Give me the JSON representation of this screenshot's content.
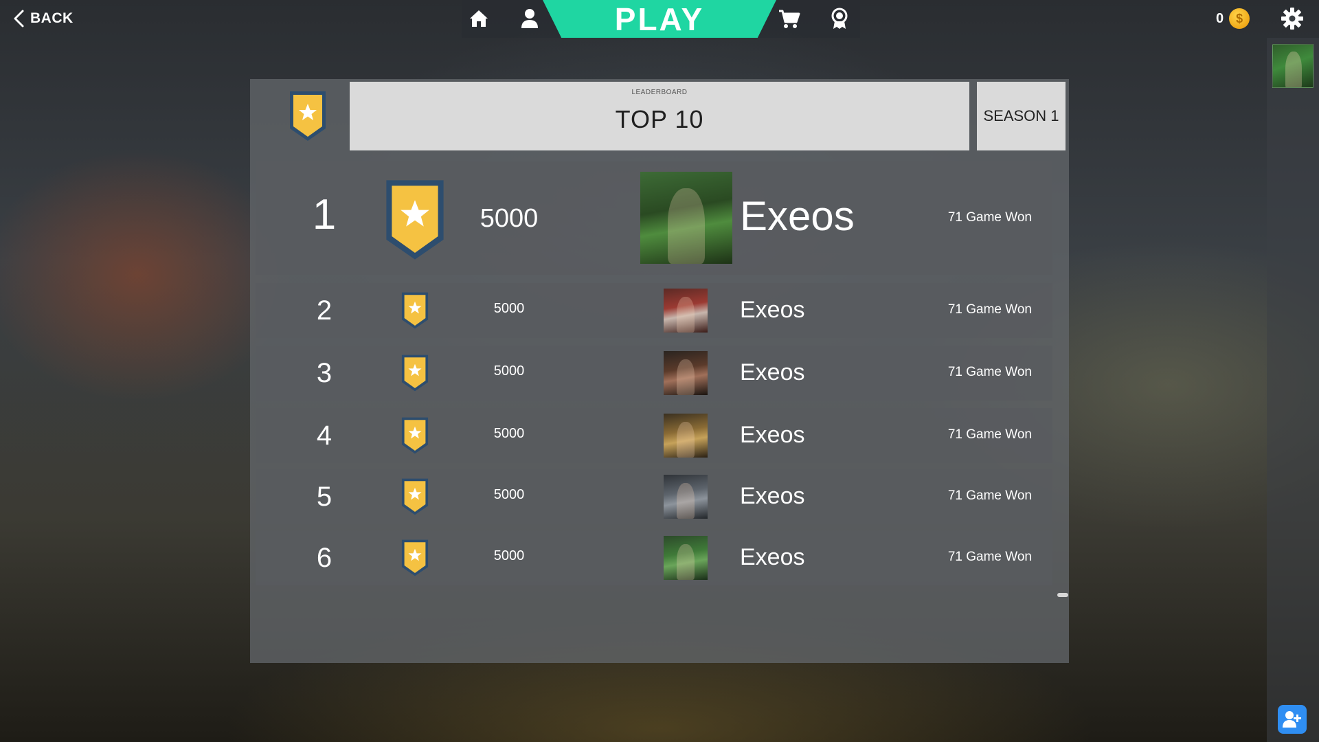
{
  "topbar": {
    "back_label": "BACK",
    "play_label": "PLAY",
    "coins": "0",
    "coin_symbol": "$",
    "nav_icons": [
      "home-icon",
      "user-icon",
      "cart-icon",
      "award-icon"
    ]
  },
  "leaderboard": {
    "small_title": "LEADERBOARD",
    "title": "TOP 10",
    "season": "SEASON 1",
    "rows": [
      {
        "rank": "1",
        "score": "5000",
        "name": "Exeos",
        "won": "71 Game Won"
      },
      {
        "rank": "2",
        "score": "5000",
        "name": "Exeos",
        "won": "71 Game Won"
      },
      {
        "rank": "3",
        "score": "5000",
        "name": "Exeos",
        "won": "71 Game Won"
      },
      {
        "rank": "4",
        "score": "5000",
        "name": "Exeos",
        "won": "71 Game Won"
      },
      {
        "rank": "5",
        "score": "5000",
        "name": "Exeos",
        "won": "71 Game Won"
      },
      {
        "rank": "6",
        "score": "5000",
        "name": "Exeos",
        "won": "71 Game Won"
      }
    ]
  },
  "colors": {
    "play": "#1fd6a2",
    "badge_gold": "#f5c242",
    "badge_frame": "#2d4d6e",
    "add_friend": "#2f8ef2"
  }
}
